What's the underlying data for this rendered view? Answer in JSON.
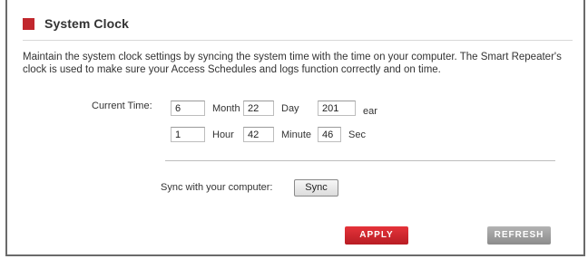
{
  "section": {
    "title": "System Clock",
    "accent_color": "#c1272d",
    "description": "Maintain the system clock settings by syncing the system time with the time on your computer. The Smart Repeater's clock is used to make sure your Access Schedules and logs function correctly and on time."
  },
  "clock": {
    "current_time_label": "Current Time:",
    "month_value": "6",
    "month_label": "Month",
    "day_value": "22",
    "day_label": "Day",
    "year_value": "201",
    "year_label": "ear",
    "hour_value": "1",
    "hour_label": "Hour",
    "minute_value": "42",
    "minute_label": "Minute",
    "second_value": "46",
    "second_label": "Sec"
  },
  "sync": {
    "label": "Sync with your computer:",
    "button_label": "Sync"
  },
  "actions": {
    "apply_label": "APPLY",
    "apply_color": "#c92a30",
    "refresh_label": "REFRESH",
    "refresh_color": "#9e9e9e"
  }
}
